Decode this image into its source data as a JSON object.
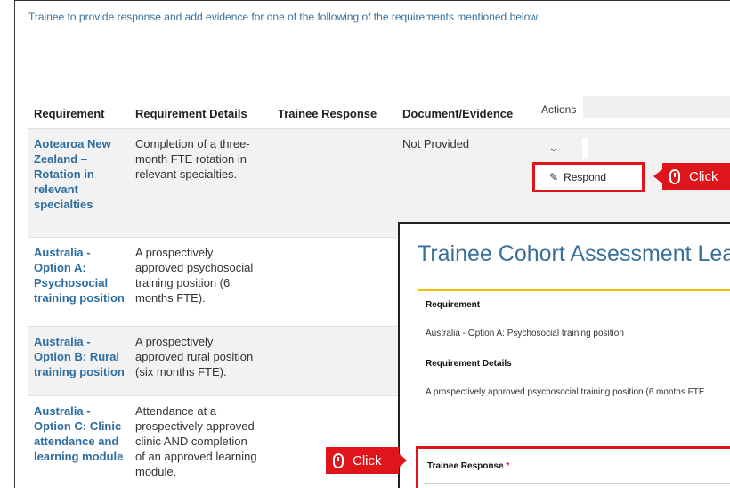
{
  "intro_text": "Trainee to provide response and add evidence for one of the following of the requirements mentioned below",
  "table": {
    "headers": {
      "requirement": "Requirement",
      "details": "Requirement Details",
      "response": "Trainee Response",
      "document": "Document/Evidence",
      "actions": "Actions"
    },
    "rows": [
      {
        "requirement": [
          "Aotearoa New",
          "Zealand –",
          "Rotation in",
          "relevant",
          "specialties"
        ],
        "details": [
          "Completion of a three-",
          "month FTE rotation in",
          "relevant specialties."
        ],
        "document": "Not Provided",
        "expand_icon": "chevron-down-icon"
      },
      {
        "requirement": [
          "Australia -",
          "Option A:",
          "Psychosocial",
          "training position"
        ],
        "details": [
          "A prospectively",
          "approved psychosocial",
          "training position (6",
          "months FTE)."
        ]
      },
      {
        "requirement": [
          "Australia -",
          "Option B: Rural",
          "training position"
        ],
        "details": [
          "A prospectively",
          "approved rural position",
          "(six months FTE)."
        ]
      },
      {
        "requirement": [
          "Australia -",
          "Option C: Clinic",
          "attendance and",
          "learning module"
        ],
        "details": [
          "Attendance at a",
          "prospectively approved",
          "clinic AND completion",
          "of an approved learning",
          "module."
        ]
      }
    ]
  },
  "respond_button": {
    "label": "Respond",
    "icon": "edit-icon"
  },
  "annotations": {
    "click_label": "Click",
    "icon": "mouse-icon",
    "color": "#e0151b"
  },
  "modal": {
    "title": "Trainee Cohort Assessment Lea",
    "requirement_label": "Requirement",
    "requirement_value": "Australia - Option A: Psychosocial training position",
    "details_label": "Requirement Details",
    "details_value": "A prospectively approved psychosocial training position (6 months FTE",
    "response_label": "Trainee Response",
    "required_marker": "*"
  },
  "colors": {
    "link_blue": "#2e6d9e",
    "accent_yellow": "#f2c200",
    "highlight_red": "#e0151b"
  }
}
